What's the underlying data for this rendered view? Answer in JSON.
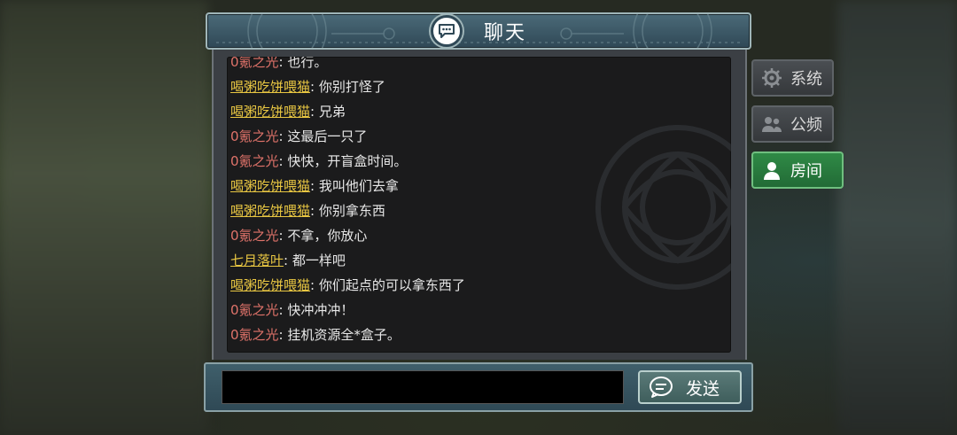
{
  "header": {
    "title": "聊天",
    "icon": "chat-bubble-icon"
  },
  "tabs": [
    {
      "label": "系统",
      "icon": "system-icon",
      "active": false
    },
    {
      "label": "公频",
      "icon": "public-channel-icon",
      "active": false
    },
    {
      "label": "房间",
      "icon": "person-icon",
      "active": true
    }
  ],
  "messages": [
    {
      "sender": "0氪之光",
      "text": "也行。",
      "sender_color": "red"
    },
    {
      "sender": "喝粥吃饼喂猫",
      "text": "你别打怪了",
      "sender_color": "yellow"
    },
    {
      "sender": "喝粥吃饼喂猫",
      "text": "兄弟",
      "sender_color": "yellow"
    },
    {
      "sender": "0氪之光",
      "text": "这最后一只了",
      "sender_color": "red"
    },
    {
      "sender": "0氪之光",
      "text": "快快，开盲盒时间。",
      "sender_color": "red"
    },
    {
      "sender": "喝粥吃饼喂猫",
      "text": "我叫他们去拿",
      "sender_color": "yellow"
    },
    {
      "sender": "喝粥吃饼喂猫",
      "text": "你别拿东西",
      "sender_color": "yellow"
    },
    {
      "sender": "0氪之光",
      "text": "不拿，你放心",
      "sender_color": "red"
    },
    {
      "sender": "七月落叶",
      "text": "都一样吧",
      "sender_color": "yellow"
    },
    {
      "sender": "喝粥吃饼喂猫",
      "text": "你们起点的可以拿东西了",
      "sender_color": "yellow"
    },
    {
      "sender": "0氪之光",
      "text": "快冲冲冲！",
      "sender_color": "red"
    },
    {
      "sender": "0氪之光",
      "text": "挂机资源全*盒子。",
      "sender_color": "red"
    }
  ],
  "separator": ":",
  "input": {
    "value": "",
    "placeholder": ""
  },
  "send": {
    "label": "发送",
    "icon": "chat-bubble-icon"
  },
  "colors": {
    "sender_red": "#e0736a",
    "sender_yellow": "#e8c642",
    "tab_active": "#2f8a46",
    "header": "#3d5a67"
  }
}
